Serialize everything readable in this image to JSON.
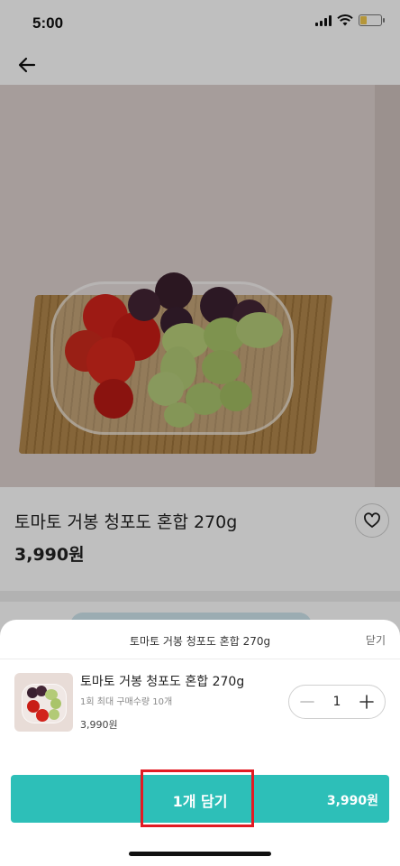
{
  "status_bar": {
    "time": "5:00",
    "battery_level": 0.3
  },
  "nav": {
    "back_icon": "arrow-left-icon"
  },
  "product": {
    "name": "토마토 거봉 청포도 혼합 270g",
    "price": "3,990원",
    "wishlist_icon": "heart-icon",
    "image_carousel": {
      "pages": 3,
      "active_page": 3
    }
  },
  "sheet": {
    "title": "토마토 거봉 청포도 혼합 270g",
    "close_label": "닫기",
    "item": {
      "name": "토마토 거봉 청포도 혼합 270g",
      "limit_text": "1회 최대 구매수량 10개",
      "price": "3,990원",
      "quantity": "1"
    },
    "cart_button": {
      "label": "1개 담기",
      "total": "3,990원"
    }
  },
  "colors": {
    "accent": "#2dbfb8",
    "highlight": "#e21b23"
  }
}
